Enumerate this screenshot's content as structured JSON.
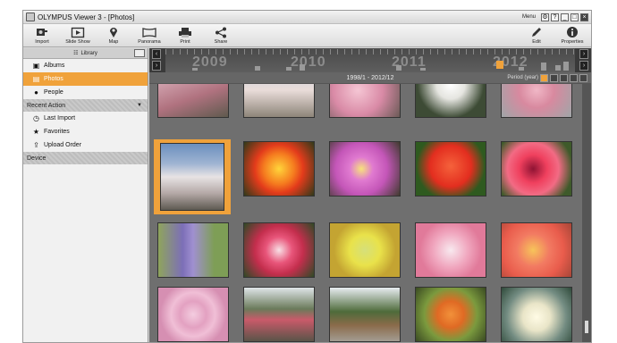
{
  "window": {
    "title": "OLYMPUS Viewer 3 - [Photos]",
    "menu_label": "Menu"
  },
  "toolbar": {
    "tools": [
      {
        "label": "Import",
        "icon": "import-icon"
      },
      {
        "label": "Slide Show",
        "icon": "slideshow-icon"
      },
      {
        "label": "Map",
        "icon": "map-pin-icon"
      },
      {
        "label": "Panorama",
        "icon": "panorama-icon"
      },
      {
        "label": "Print",
        "icon": "printer-icon"
      },
      {
        "label": "Share",
        "icon": "share-icon"
      }
    ],
    "right_tools": [
      {
        "label": "Edit",
        "icon": "pencil-icon"
      },
      {
        "label": "Properties",
        "icon": "info-icon"
      }
    ]
  },
  "sidebar": {
    "library_label": "Library",
    "items": [
      {
        "label": "Albums",
        "icon": "album-icon"
      },
      {
        "label": "Photos",
        "icon": "photos-icon",
        "active": true
      },
      {
        "label": "People",
        "icon": "person-icon"
      }
    ],
    "recent_action": {
      "header": "Recent Action",
      "items": [
        {
          "label": "Last Import",
          "icon": "clock-icon"
        },
        {
          "label": "Favorites",
          "icon": "star-icon"
        },
        {
          "label": "Upload Order",
          "icon": "upload-icon"
        }
      ]
    },
    "device_header": "Device"
  },
  "timeline": {
    "years": [
      "2009",
      "2010",
      "2011",
      "2012"
    ],
    "range_text": "1998/1 - 2012/12",
    "period_label": "Period (year)"
  },
  "colors": {
    "accent": "#f0a23b",
    "main_bg": "#6f6f6f"
  },
  "photos": {
    "rows": [
      [
        "pink-blossom",
        "cherry-tree",
        "pink-blossom-2",
        "white-lily",
        "pink-blossom-3"
      ],
      [
        "cherry-tree-selected",
        "tulip-orange",
        "orchid-pink",
        "rose-red",
        "hibiscus"
      ],
      [
        "lavender",
        "red-flower",
        "yellow-flower",
        "pink-flower",
        "coral-flower"
      ],
      [
        "pink-rose",
        "garden-flowers",
        "garden-path",
        "orange-flowers",
        "white-flower"
      ]
    ],
    "selected_index": 5
  }
}
